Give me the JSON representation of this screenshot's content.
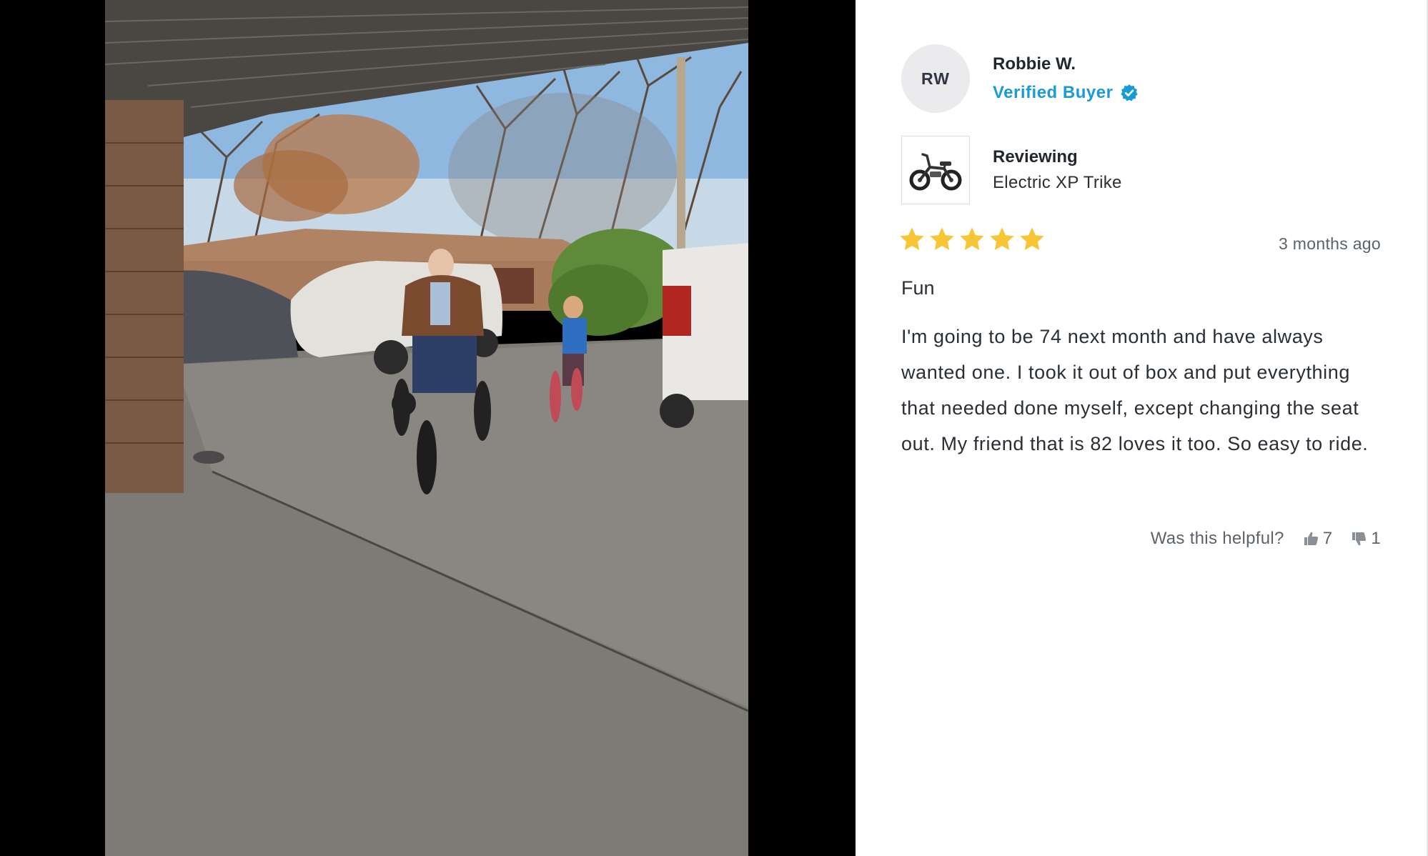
{
  "reviewer": {
    "initials": "RW",
    "name": "Robbie W.",
    "badge": "Verified Buyer"
  },
  "product": {
    "reviewing_label": "Reviewing",
    "name": "Electric XP Trike",
    "thumbnail_icon": "trike-icon"
  },
  "review": {
    "rating": 5,
    "rating_max": 5,
    "date": "3 months ago",
    "title": "Fun",
    "body": "I'm going to be 74 next month and have always wanted one. I took it out of box and put everything that needed done myself, except changing the seat out. My friend that is 82 loves it too. So easy to ride."
  },
  "helpful": {
    "prompt": "Was this helpful?",
    "up_count": "7",
    "down_count": "1"
  },
  "colors": {
    "accent": "#1a9bd7",
    "star": "#f6c636",
    "photo_background": "#000000"
  }
}
